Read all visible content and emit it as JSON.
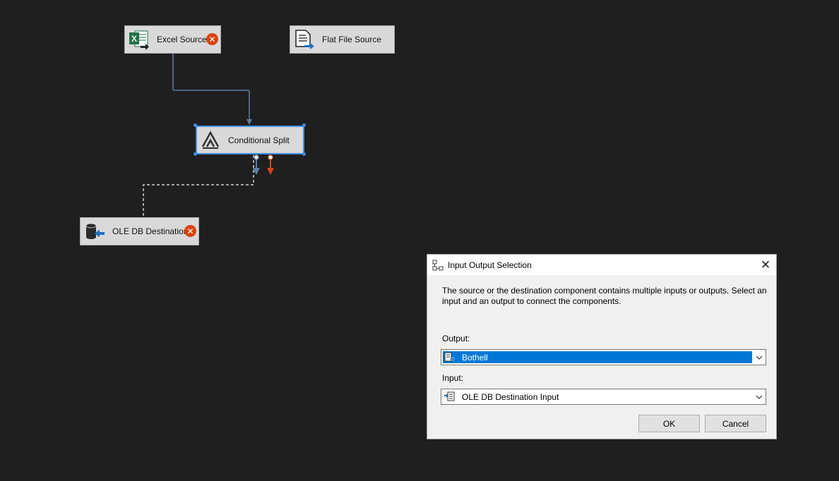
{
  "canvas": {
    "nodes": {
      "excel_source": {
        "label": "Excel Source",
        "has_error": true,
        "icon": "excel-source-icon"
      },
      "flat_file_source": {
        "label": "Flat File Source",
        "has_error": false,
        "icon": "flat-file-source-icon"
      },
      "conditional_split": {
        "label": "Conditional Split",
        "selected": true,
        "icon": "conditional-split-icon"
      },
      "ole_db_destination": {
        "label": "OLE DB Destination",
        "has_error": true,
        "icon": "ole-db-destination-icon"
      }
    },
    "error_glyph": "✕",
    "colors": {
      "background": "#1f1f1f",
      "node": "#d9d9da",
      "selection": "#3d8ee0",
      "data_path": "#5b7fa6",
      "error_path": "#d9430f",
      "pending_path": "#d0d0d0"
    }
  },
  "dialog": {
    "title": "Input Output Selection",
    "close_glyph": "✕",
    "description": "The source or the destination component contains multiple inputs or outputs. Select an input and an output to connect the components.",
    "output_label": "Output:",
    "output_value": "Bothell",
    "input_label": "Input:",
    "input_value": "OLE DB Destination Input",
    "ok_label": "OK",
    "cancel_label": "Cancel",
    "accent": "#0078d7"
  }
}
